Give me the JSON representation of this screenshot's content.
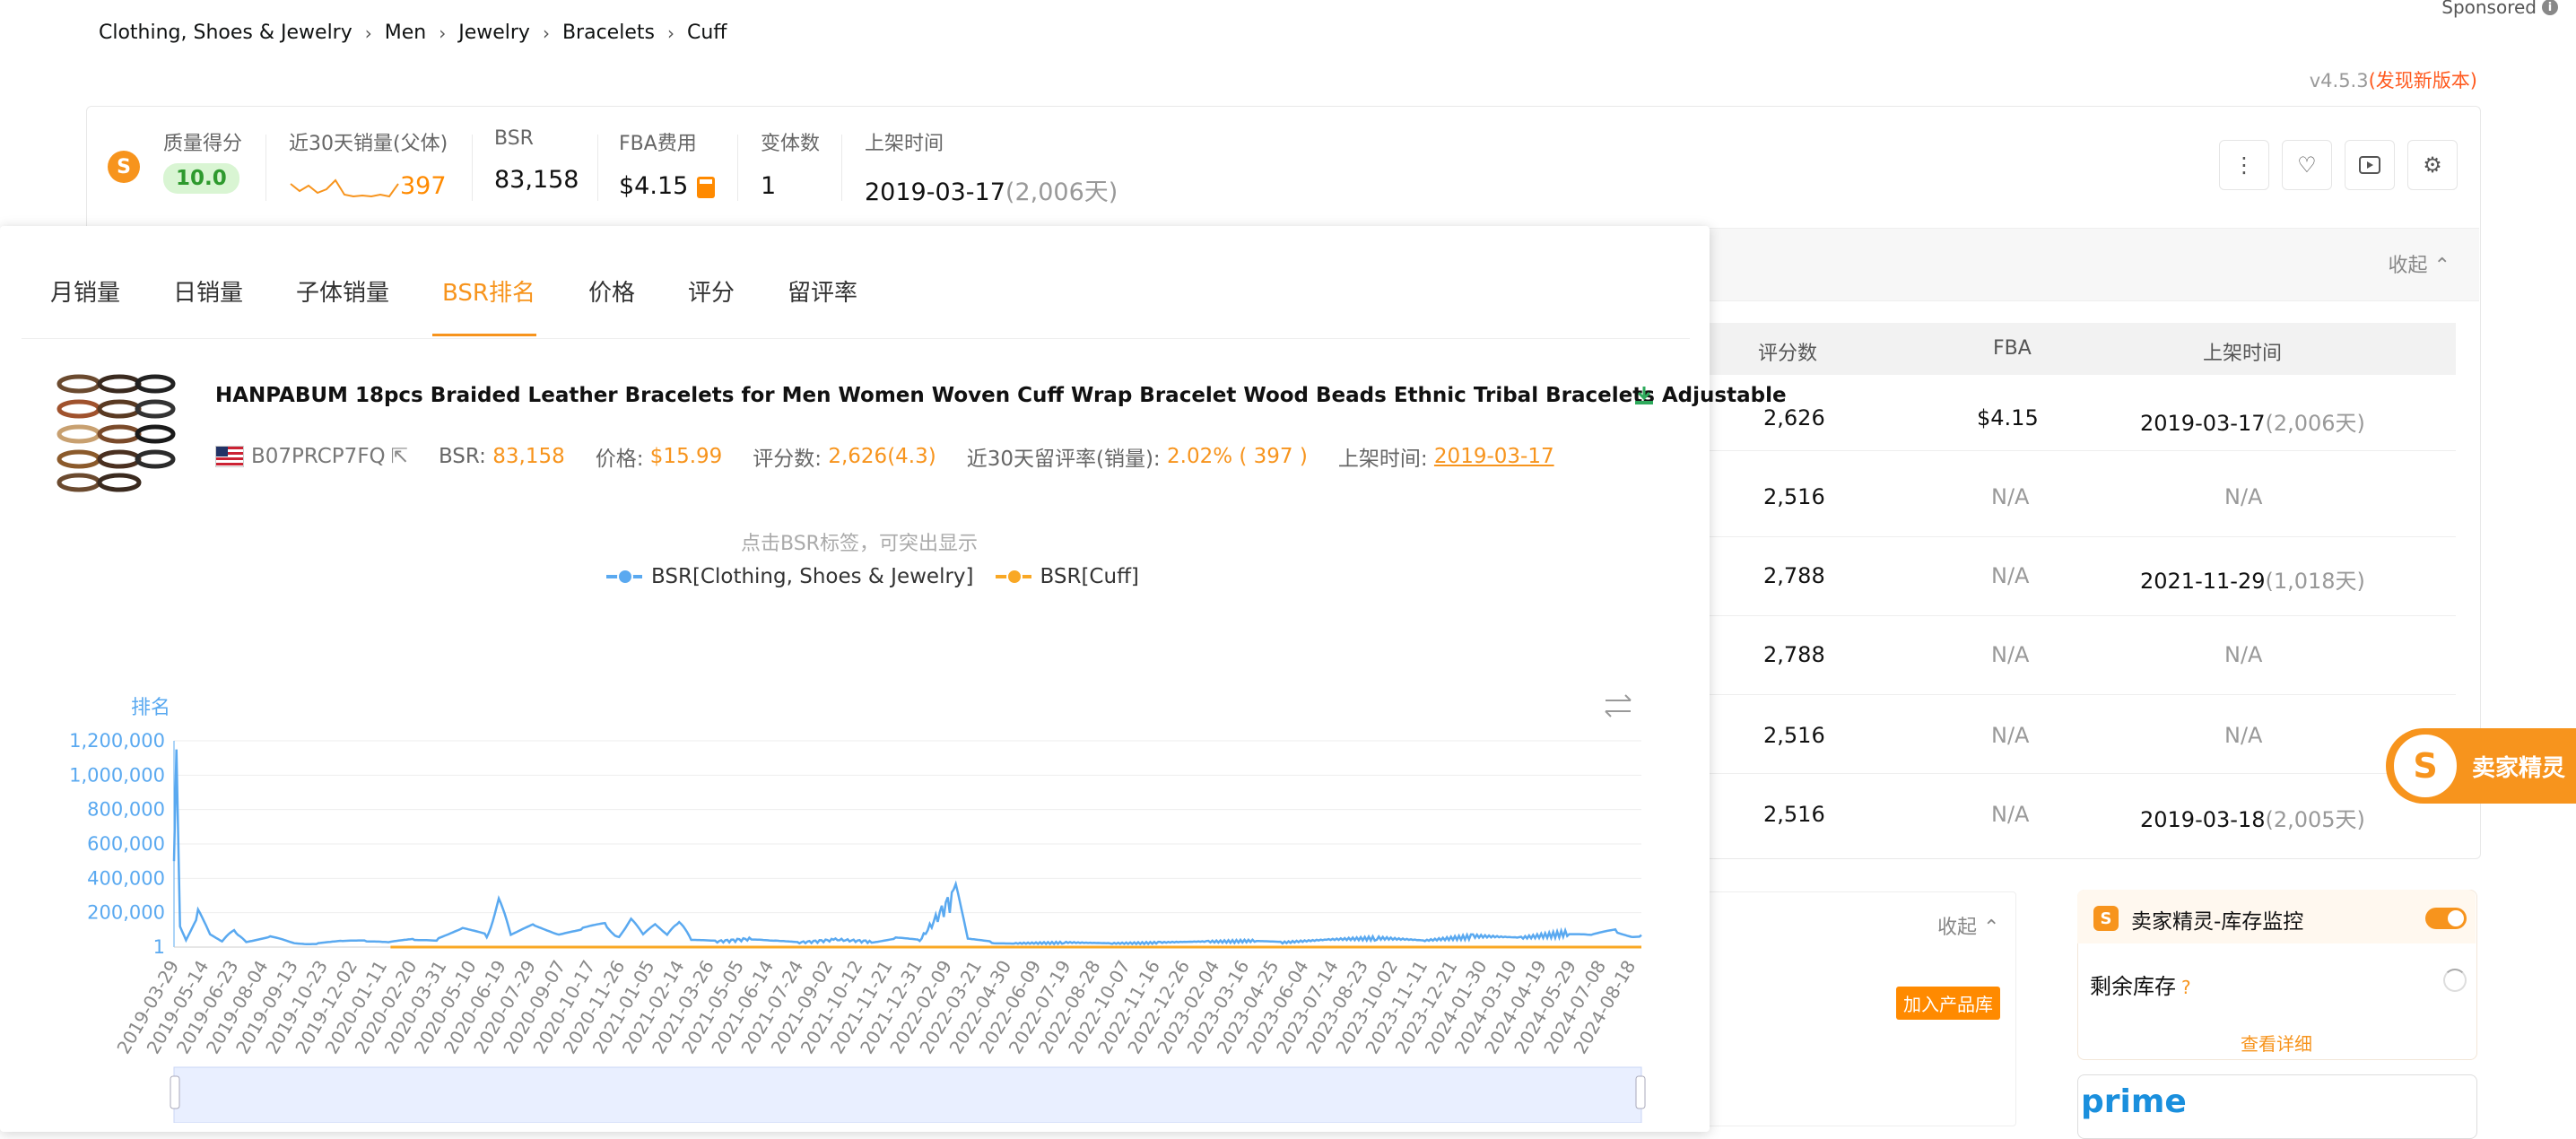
{
  "breadcrumb": [
    "Clothing, Shoes & Jewelry",
    "Men",
    "Jewelry",
    "Bracelets",
    "Cuff"
  ],
  "sponsored": "Sponsored",
  "version": {
    "num": "v4.5.3",
    "update": "(发现新版本)"
  },
  "stats": {
    "quality_label": "质量得分",
    "quality_value": "10.0",
    "sales_label": "近30天销量(父体)",
    "sales_value": "397",
    "bsr_label": "BSR",
    "bsr_value": "83,158",
    "fba_label": "FBA费用",
    "fba_value": "$4.15",
    "variants_label": "变体数",
    "variants_value": "1",
    "listed_label": "上架时间",
    "listed_value": "2019-03-17",
    "listed_days": "(2,006天)"
  },
  "background": {
    "collapse": "收起",
    "headers": {
      "reviews": "评分数",
      "fba": "FBA",
      "listed": "上架时间"
    },
    "rows": [
      {
        "reviews": "2,626",
        "fba": "$4.15",
        "listed": "2019-03-17",
        "days": "(2,006天)"
      },
      {
        "reviews": "2,516",
        "fba": "N/A",
        "listed": "N/A",
        "days": ""
      },
      {
        "reviews": "2,788",
        "fba": "N/A",
        "listed": "2021-11-29",
        "days": "(1,018天)"
      },
      {
        "reviews": "2,788",
        "fba": "N/A",
        "listed": "N/A",
        "days": ""
      },
      {
        "reviews": "2,516",
        "fba": "N/A",
        "listed": "N/A",
        "days": ""
      },
      {
        "reviews": "2,516",
        "fba": "N/A",
        "listed": "2019-03-18",
        "days": "(2,005天)"
      }
    ],
    "collapse2": "收起",
    "add_library": "加入产品库",
    "monitor_title": "卖家精灵-库存监控",
    "stock_label": "剩余库存",
    "view_detail": "查看详细",
    "prime": "prime",
    "brand": "卖家精灵"
  },
  "popup": {
    "tabs": [
      "月销量",
      "日销量",
      "子体销量",
      "BSR排名",
      "价格",
      "评分",
      "留评率"
    ],
    "active_tab": 3,
    "product_title": "HANPABUM 18pcs Braided Leather Bracelets for Men Women Woven Cuff Wrap Bracelet Wood Beads Ethnic Tribal Bracelets Adjustable",
    "asin": "B07PRCP7FQ",
    "bsr_label": "BSR:",
    "bsr_value": "83,158",
    "price_label": "价格:",
    "price_value": "$15.99",
    "reviews_label": "评分数:",
    "reviews_value": "2,626(4.3)",
    "rate_label": "近30天留评率(销量):",
    "rate_value": "2.02% ( 397 )",
    "listed_label": "上架时间:",
    "listed_value": "2019-03-17",
    "hint": "点击BSR标签，可突出显示"
  },
  "colors": {
    "accent": "#f7941d",
    "blue": "#5aa9f0",
    "orange": "#f9a825"
  },
  "chart_data": {
    "type": "line",
    "ylabel": "排名",
    "yticks": [
      "1,200,000",
      "1,000,000",
      "800,000",
      "600,000",
      "400,000",
      "200,000",
      "1"
    ],
    "ylim": [
      1,
      1200000
    ],
    "xticks": [
      "2019-03-29",
      "2019-05-14",
      "2019-06-23",
      "2019-08-04",
      "2019-09-13",
      "2019-10-23",
      "2019-12-02",
      "2020-01-11",
      "2020-02-20",
      "2020-03-31",
      "2020-05-10",
      "2020-06-19",
      "2020-07-29",
      "2020-09-07",
      "2020-10-17",
      "2020-11-26",
      "2021-01-05",
      "2021-02-14",
      "2021-03-26",
      "2021-05-05",
      "2021-06-14",
      "2021-07-24",
      "2021-09-02",
      "2021-10-12",
      "2021-11-21",
      "2021-12-31",
      "2022-02-09",
      "2022-03-21",
      "2022-04-30",
      "2022-06-09",
      "2022-07-19",
      "2022-08-28",
      "2022-10-07",
      "2022-11-16",
      "2022-12-26",
      "2023-02-04",
      "2023-03-16",
      "2023-04-25",
      "2023-06-04",
      "2023-07-14",
      "2023-08-23",
      "2023-10-02",
      "2023-11-11",
      "2023-12-21",
      "2024-01-30",
      "2024-03-10",
      "2024-04-19",
      "2024-05-29",
      "2024-07-08",
      "2024-08-18"
    ],
    "series": [
      {
        "name": "BSR[Clothing, Shoes & Jewelry]",
        "color": "#5aa9f0",
        "points": [
          [
            0,
            500000
          ],
          [
            0.2,
            1150000
          ],
          [
            0.5,
            120000
          ],
          [
            1,
            40000
          ],
          [
            2,
            180000
          ],
          [
            3,
            60000
          ],
          [
            4,
            30000
          ],
          [
            5,
            120000
          ],
          [
            6,
            30000
          ],
          [
            8,
            50000
          ],
          [
            9,
            40000
          ],
          [
            10,
            25000
          ],
          [
            12,
            20000
          ],
          [
            14,
            30000
          ],
          [
            16,
            40000
          ],
          [
            18,
            25000
          ],
          [
            20,
            40000
          ],
          [
            22,
            50000
          ],
          [
            24,
            90000
          ],
          [
            26,
            70000
          ],
          [
            27,
            290000
          ],
          [
            28,
            60000
          ],
          [
            30,
            110000
          ],
          [
            32,
            80000
          ],
          [
            34,
            90000
          ],
          [
            36,
            120000
          ],
          [
            37,
            70000
          ],
          [
            38,
            150000
          ],
          [
            39,
            60000
          ],
          [
            40,
            110000
          ],
          [
            41,
            70000
          ],
          [
            42,
            190000
          ],
          [
            43,
            40000
          ],
          [
            45,
            30000
          ],
          [
            48,
            45000
          ],
          [
            50,
            30000
          ],
          [
            52,
            25000
          ],
          [
            55,
            40000
          ],
          [
            58,
            30000
          ],
          [
            60,
            45000
          ],
          [
            62,
            35000
          ],
          [
            65,
            300000
          ],
          [
            66,
            40000
          ],
          [
            68,
            30000
          ],
          [
            70,
            20000
          ],
          [
            74,
            25000
          ],
          [
            78,
            20000
          ],
          [
            82,
            25000
          ],
          [
            86,
            30000
          ],
          [
            90,
            35000
          ],
          [
            92,
            25000
          ],
          [
            96,
            40000
          ],
          [
            100,
            50000
          ],
          [
            104,
            35000
          ],
          [
            108,
            60000
          ],
          [
            112,
            50000
          ],
          [
            116,
            80000
          ],
          [
            118,
            60000
          ],
          [
            120,
            90000
          ],
          [
            122,
            70000
          ]
        ]
      },
      {
        "name": "BSR[Cuff]",
        "color": "#f9a825",
        "points": [
          [
            18,
            1
          ],
          [
            30,
            1
          ],
          [
            50,
            1
          ],
          [
            70,
            1
          ],
          [
            90,
            1
          ],
          [
            110,
            1
          ],
          [
            122,
            1
          ]
        ]
      }
    ]
  }
}
